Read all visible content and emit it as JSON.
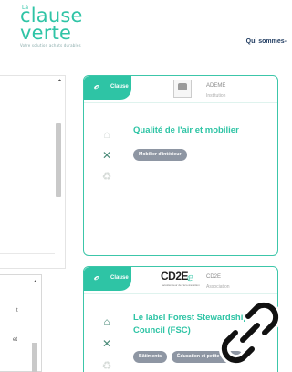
{
  "header": {
    "logo_prefix": "La",
    "logo_word1": "clause",
    "logo_word2": "verte",
    "logo_tagline": "Votre solution achats durables",
    "nav_link": "Qui sommes-"
  },
  "left_panel": {
    "lower_lines": [
      "t",
      "et"
    ]
  },
  "cards": [
    {
      "badge_label": "Clause",
      "org_name": "ADEME",
      "org_type": "Institution",
      "title_lines": [
        "Qualité de l'air et mobilier"
      ],
      "tags": [
        "Mobilier d'intérieur"
      ]
    },
    {
      "badge_label": "Clause",
      "org_logo_text": "CD2E",
      "org_logo_small": "accélérateur de l'éco-transition",
      "org_name": "CD2E",
      "org_type": "Association",
      "title_lines": [
        "Le label Forest Stewardship",
        "Council (FSC)"
      ],
      "tags": [
        "Bâtiments",
        "Éducation et petite enfance"
      ]
    }
  ],
  "colors": {
    "accent": "#2ec4a5",
    "nav_text": "#1e3a5f",
    "tag_bg": "#8e96a3"
  },
  "icons": {
    "share": "link-icon",
    "clause_badge": "leaf-icon",
    "category_building": "building-icon",
    "category_tools": "tools-icon",
    "category_misc": "recycle-icon"
  }
}
